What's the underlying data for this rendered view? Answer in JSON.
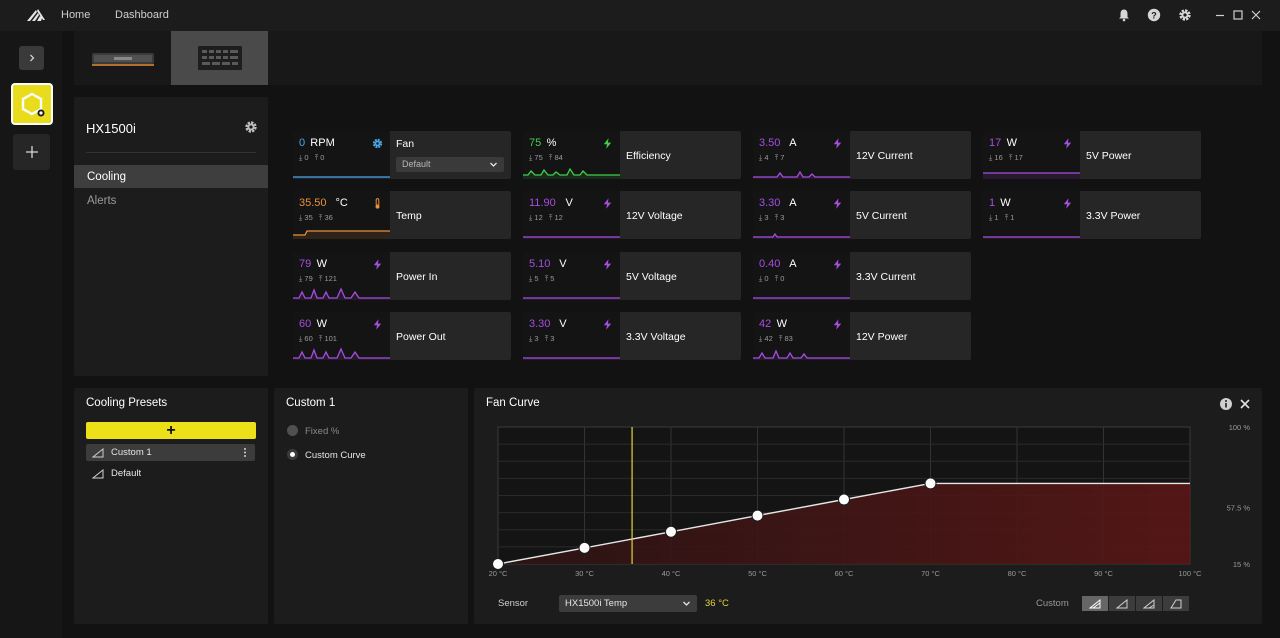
{
  "nav": {
    "home": "Home",
    "dashboard": "Dashboard"
  },
  "device": {
    "name": "HX1500i"
  },
  "menu": {
    "cooling": "Cooling",
    "alerts": "Alerts"
  },
  "tiles": [
    {
      "id": "fan",
      "value": "0",
      "unit": "RPM",
      "min": "0",
      "max": "0",
      "label": "Fan",
      "icon": "gear-icon",
      "color": "#4aa7e8",
      "select": "Default"
    },
    {
      "id": "temp",
      "value": "35.50",
      "unit": "°C",
      "min": "35",
      "max": "36",
      "label": "Temp",
      "icon": "thermometer-icon",
      "color": "#e8903a"
    },
    {
      "id": "power-in",
      "value": "79",
      "unit": "W",
      "min": "79",
      "max": "121",
      "label": "Power In",
      "icon": "lightning-icon",
      "color": "#a64ee0"
    },
    {
      "id": "power-out",
      "value": "60",
      "unit": "W",
      "min": "60",
      "max": "101",
      "label": "Power Out",
      "icon": "lightning-icon",
      "color": "#a64ee0"
    },
    {
      "id": "efficiency",
      "value": "75",
      "unit": "%",
      "min": "75",
      "max": "84",
      "label": "Efficiency",
      "icon": "lightning-icon",
      "color": "#3fcf4a"
    },
    {
      "id": "12v-voltage",
      "value": "11.90",
      "unit": "V",
      "min": "12",
      "max": "12",
      "label": "12V Voltage",
      "icon": "lightning-icon",
      "color": "#a64ee0"
    },
    {
      "id": "5v-voltage",
      "value": "5.10",
      "unit": "V",
      "min": "5",
      "max": "5",
      "label": "5V Voltage",
      "icon": "lightning-icon",
      "color": "#a64ee0"
    },
    {
      "id": "3v3-voltage",
      "value": "3.30",
      "unit": "V",
      "min": "3",
      "max": "3",
      "label": "3.3V Voltage",
      "icon": "lightning-icon",
      "color": "#a64ee0"
    },
    {
      "id": "12v-current",
      "value": "3.50",
      "unit": "A",
      "min": "4",
      "max": "7",
      "label": "12V Current",
      "icon": "lightning-icon",
      "color": "#a64ee0"
    },
    {
      "id": "5v-current",
      "value": "3.30",
      "unit": "A",
      "min": "3",
      "max": "3",
      "label": "5V Current",
      "icon": "lightning-icon",
      "color": "#a64ee0"
    },
    {
      "id": "3v3-current",
      "value": "0.40",
      "unit": "A",
      "min": "0",
      "max": "0",
      "label": "3.3V Current",
      "icon": "lightning-icon",
      "color": "#a64ee0"
    },
    {
      "id": "12v-power",
      "value": "42",
      "unit": "W",
      "min": "42",
      "max": "83",
      "label": "12V Power",
      "icon": "lightning-icon",
      "color": "#a64ee0"
    },
    {
      "id": "5v-power",
      "value": "17",
      "unit": "W",
      "min": "16",
      "max": "17",
      "label": "5V Power",
      "icon": "lightning-icon",
      "color": "#a64ee0"
    },
    {
      "id": "3v3-power",
      "value": "1",
      "unit": "W",
      "min": "1",
      "max": "1",
      "label": "3.3V Power",
      "icon": "lightning-icon",
      "color": "#a64ee0"
    }
  ],
  "presets": {
    "title": "Cooling Presets",
    "add": "+",
    "items": [
      "Custom 1",
      "Default"
    ]
  },
  "custom": {
    "title": "Custom 1",
    "fixed": "Fixed %",
    "curve": "Custom Curve"
  },
  "fan_curve": {
    "title": "Fan Curve",
    "x_ticks": [
      "20 °C",
      "30 °C",
      "40 °C",
      "50 °C",
      "60 °C",
      "70 °C",
      "80 °C",
      "90 °C",
      "100 °C"
    ],
    "y_ticks": [
      "100 %",
      "57.5 %",
      "15 %"
    ],
    "xlim": [
      20,
      100
    ],
    "ylim": [
      15,
      100
    ],
    "points": [
      [
        20,
        15
      ],
      [
        30,
        25
      ],
      [
        40,
        35
      ],
      [
        50,
        45
      ],
      [
        60,
        55
      ],
      [
        70,
        65
      ],
      [
        100,
        65
      ]
    ],
    "current_temp": 35.5,
    "sensor_label": "Sensor",
    "sensor_value": "HX1500i Temp",
    "sensor_temp": "36 °C",
    "mode_label": "Custom"
  },
  "colors": {
    "accent": "#ece118",
    "curve_fill": "#5a1616",
    "marker": "#e0d43a"
  }
}
